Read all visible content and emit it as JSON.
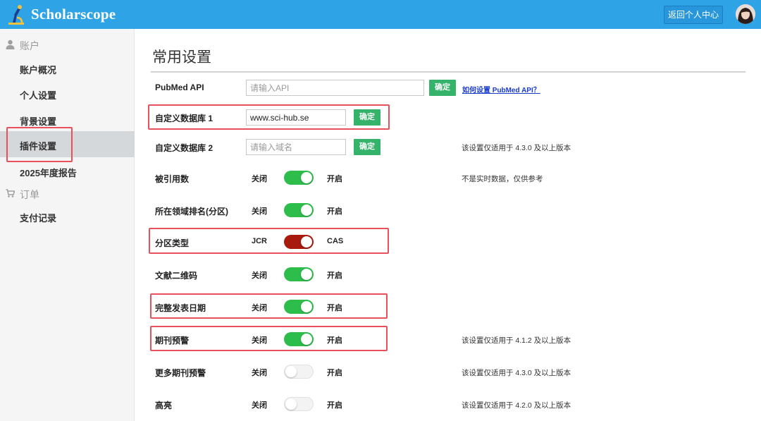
{
  "header": {
    "brand": "Scholarscope",
    "user_center_label": "返回个人中心",
    "logo_icon": "microscope-logo-icon",
    "accent_color": "#2ea3e6"
  },
  "sidebar": {
    "sections": [
      {
        "title": "账户",
        "icon": "user-icon",
        "items": [
          "账户概况",
          "个人设置",
          "背景设置",
          "插件设置",
          "2025年度报告"
        ]
      },
      {
        "title": "订单",
        "icon": "cart-icon",
        "items": [
          "支付记录"
        ]
      }
    ],
    "active_item": "插件设置"
  },
  "main": {
    "title": "常用设置",
    "pubmed": {
      "label": "PubMed API",
      "placeholder": "请输入API",
      "confirm_label": "确定",
      "help_link": "如何设置 PubMed API？"
    },
    "custom_db1": {
      "label": "自定义数据库 1",
      "value": "www.sci-hub.se",
      "confirm_label": "确定"
    },
    "custom_db2": {
      "label": "自定义数据库 2",
      "placeholder": "请输入域名",
      "confirm_label": "确定",
      "note": "该设置仅适用于 4.3.0 及以上版本"
    },
    "toggles": [
      {
        "label": "被引用数",
        "off_label": "关闭",
        "on_label": "开启",
        "enabled": true,
        "note": "不是实时数据，仅供参考"
      },
      {
        "label": "所在领域排名(分区)",
        "off_label": "关闭",
        "on_label": "开启",
        "enabled": true,
        "note": ""
      },
      {
        "label": "分区类型",
        "off_label": "JCR",
        "on_label": "CAS",
        "enabled": true,
        "note": ""
      },
      {
        "label": "文献二维码",
        "off_label": "关闭",
        "on_label": "开启",
        "enabled": true,
        "note": ""
      },
      {
        "label": "完整发表日期",
        "off_label": "关闭",
        "on_label": "开启",
        "enabled": true,
        "note": ""
      },
      {
        "label": "期刊预警",
        "off_label": "关闭",
        "on_label": "开启",
        "enabled": true,
        "note": "该设置仅适用于 4.1.2 及以上版本"
      },
      {
        "label": "更多期刊预警",
        "off_label": "关闭",
        "on_label": "开启",
        "enabled": false,
        "note": "该设置仅适用于 4.3.0 及以上版本"
      },
      {
        "label": "高亮",
        "off_label": "关闭",
        "on_label": "开启",
        "enabled": false,
        "note": "该设置仅适用于 4.2.0 及以上版本"
      }
    ],
    "colors": {
      "toggle_on": "#2dbd4a",
      "toggle_cas": "#a8190e",
      "confirm_button": "#35b36a",
      "highlight_box": "#e8505b"
    }
  }
}
